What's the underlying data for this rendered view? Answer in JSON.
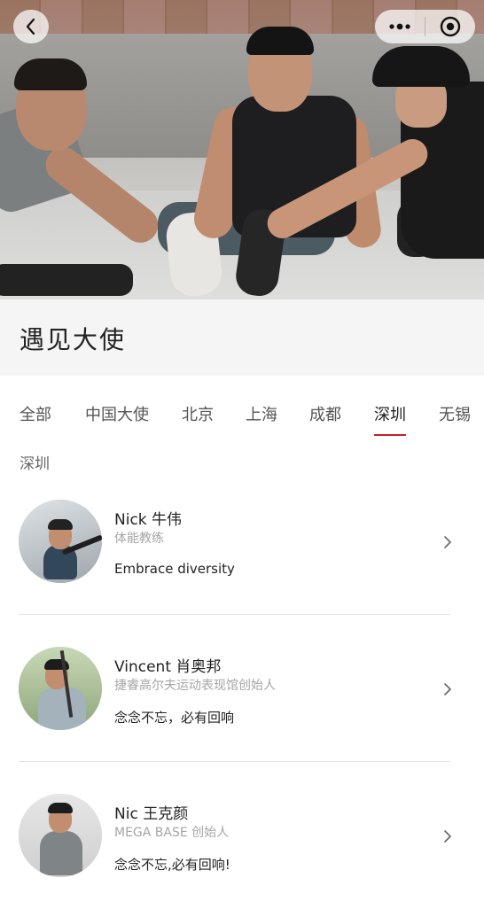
{
  "header": {
    "back_icon": "chevron-left-icon",
    "more_icon": "more-dots-icon",
    "close_icon": "target-circle-icon"
  },
  "hero": {
    "description_icon": "group-workout-photo"
  },
  "page": {
    "title": "遇见大使"
  },
  "tabs": [
    {
      "label": "全部",
      "active": false
    },
    {
      "label": "中国大使",
      "active": false
    },
    {
      "label": "北京",
      "active": false
    },
    {
      "label": "上海",
      "active": false
    },
    {
      "label": "成都",
      "active": false
    },
    {
      "label": "深圳",
      "active": true
    },
    {
      "label": "无锡",
      "active": false
    }
  ],
  "section": {
    "label": "深圳"
  },
  "ambassadors": [
    {
      "name": "Nick 牛伟",
      "role": "体能教练",
      "motto": "Embrace diversity"
    },
    {
      "name": "Vincent 肖奥邦",
      "role": "捷睿高尔夫运动表现馆创始人",
      "motto": "念念不忘，必有回响"
    },
    {
      "name": "Nic 王克颜",
      "role": "MEGA BASE 创始人",
      "motto": "念念不忘,必有回响!"
    }
  ],
  "colors": {
    "accent": "#c41f2d",
    "title_bg": "#f5f5f5",
    "muted_text": "#a5a5a5"
  }
}
